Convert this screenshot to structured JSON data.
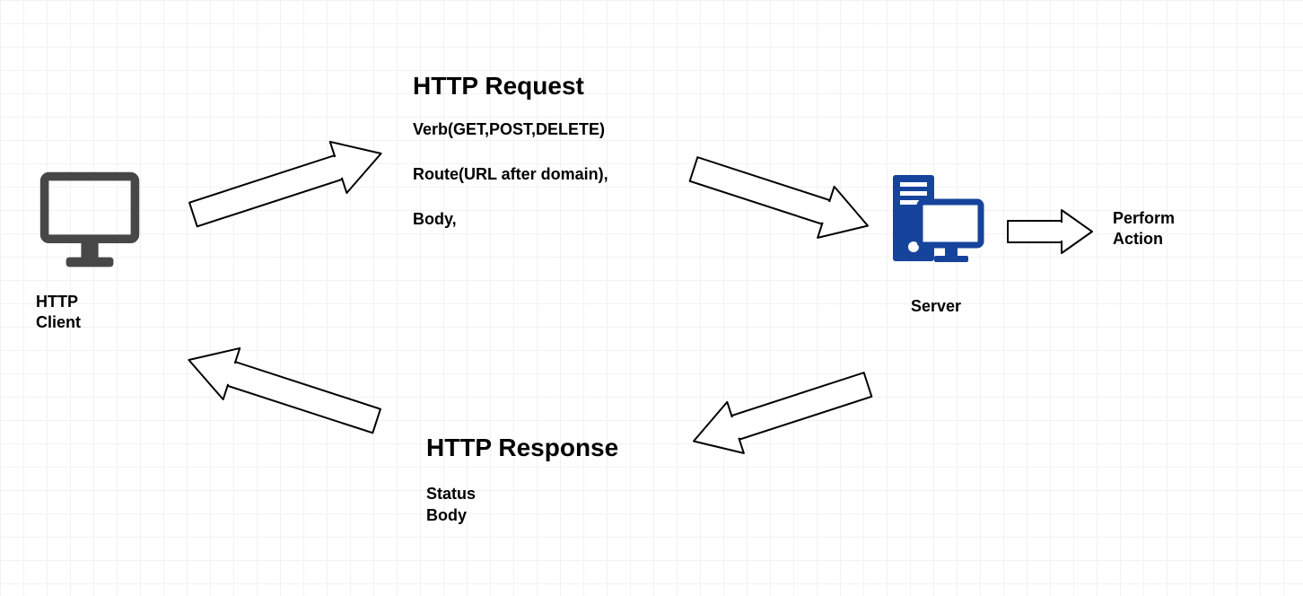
{
  "nodes": {
    "client": {
      "label": "HTTP\nClient"
    },
    "server": {
      "label": "Server"
    },
    "action": {
      "label": "Perform\nAction"
    }
  },
  "request": {
    "title": "HTTP Request",
    "verb": "Verb(GET,POST,DELETE)",
    "route": "Route(URL after domain),",
    "body": "Body,"
  },
  "response": {
    "title": "HTTP Response",
    "status": "Status",
    "body": "Body"
  }
}
